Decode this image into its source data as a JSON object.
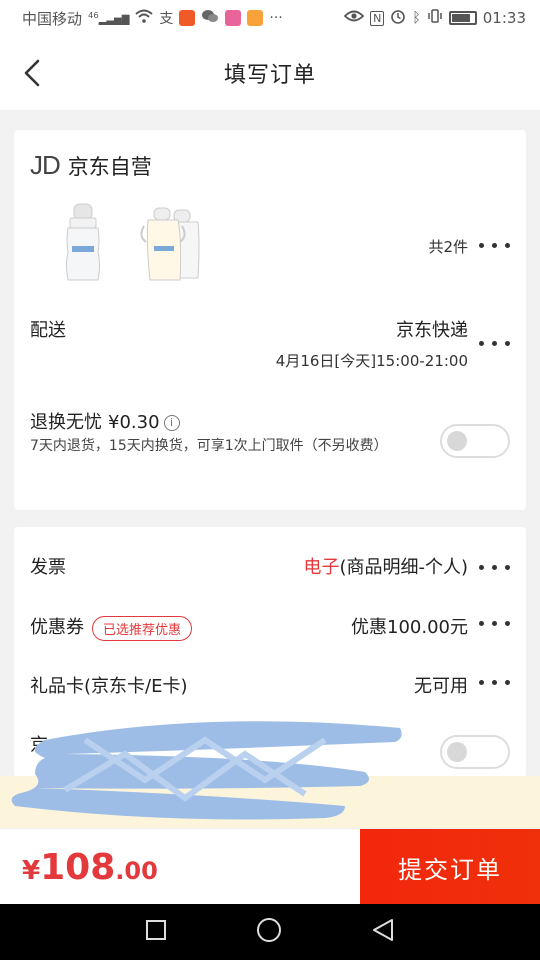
{
  "status_bar": {
    "carrier": "中国移动",
    "network": "46",
    "time": "01:33",
    "icons": [
      "signal-icon",
      "wifi-icon",
      "alipay-icon",
      "app-icon",
      "wechat-icon",
      "app-icon",
      "video-icon",
      "more-icon",
      "eye-icon",
      "nfc-icon",
      "alarm-icon",
      "bluetooth-icon",
      "vibrate-icon",
      "battery-icon"
    ]
  },
  "header": {
    "title": "填写订单",
    "back_icon": "chevron-left-icon"
  },
  "shop": {
    "logo": "JD",
    "name": "京东自营"
  },
  "products": {
    "count_label": "共2件"
  },
  "delivery": {
    "label": "配送",
    "method": "京东快递",
    "time": "4月16日[今天]15:00-21:00"
  },
  "return_service": {
    "label": "退换无忧",
    "price": "¥0.30",
    "description": "7天内退货，15天内换货，可享1次上门取件（不另收费）"
  },
  "invoice": {
    "label": "发票",
    "value_prefix": "电子",
    "value_rest": "(商品明细-个人)"
  },
  "coupon": {
    "label": "优惠券",
    "badge": "已选推荐优惠",
    "value": "优惠100.00元"
  },
  "gift_card": {
    "label": "礼品卡(京东卡/E卡)",
    "value": "无可用"
  },
  "jd_beans": {
    "label": "京"
  },
  "bottom": {
    "currency": "¥",
    "price_int": "108",
    "price_dec": ".00",
    "submit_label": "提交订单"
  },
  "colors": {
    "accent": "#e4393c",
    "submit": "#f2270c",
    "notice_bg": "#fdf4dc"
  }
}
